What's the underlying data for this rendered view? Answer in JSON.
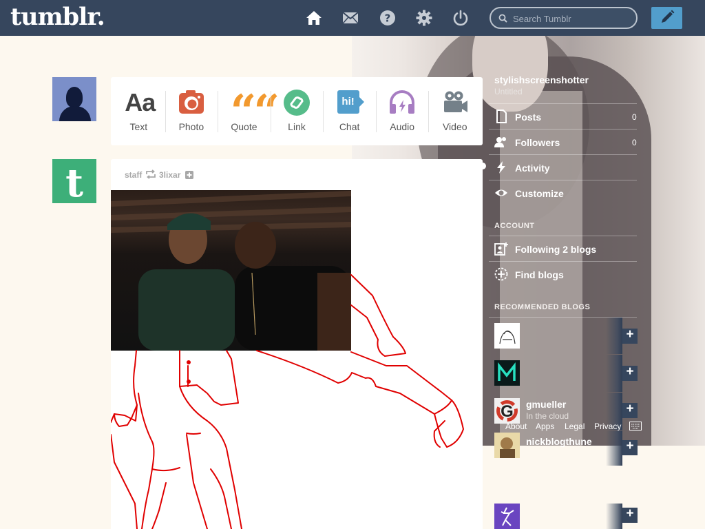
{
  "header": {
    "logo": "tumblr.",
    "search_placeholder": "Search Tumblr",
    "nav_icons": [
      "home-icon",
      "mail-icon",
      "help-icon",
      "gear-icon",
      "power-icon"
    ]
  },
  "post_types": [
    {
      "label": "Text",
      "icon": "text-icon",
      "glyph": "Aa",
      "color": "#444444"
    },
    {
      "label": "Photo",
      "icon": "camera-icon",
      "color": "#d95e40"
    },
    {
      "label": "Quote",
      "icon": "quote-icon",
      "glyph": "““",
      "color": "#f2992e"
    },
    {
      "label": "Link",
      "icon": "link-icon",
      "color": "#56bc8a"
    },
    {
      "label": "Chat",
      "icon": "chat-icon",
      "glyph": "hi!",
      "color": "#529ecc"
    },
    {
      "label": "Audio",
      "icon": "headphones-icon",
      "color": "#a77dc2"
    },
    {
      "label": "Video",
      "icon": "video-camera-icon",
      "color": "#748089"
    }
  ],
  "post": {
    "author": "staff",
    "source": "3lixar"
  },
  "sidebar": {
    "blog_name": "stylishscreenshotter",
    "blog_title": "Untitled",
    "menu": [
      {
        "label": "Posts",
        "icon": "document-icon",
        "count": "0"
      },
      {
        "label": "Followers",
        "icon": "followers-icon",
        "count": "0"
      },
      {
        "label": "Activity",
        "icon": "lightning-icon",
        "count": ""
      },
      {
        "label": "Customize",
        "icon": "eye-icon",
        "count": ""
      }
    ],
    "account_heading": "ACCOUNT",
    "account_items": [
      {
        "label": "Following 2 blogs",
        "icon": "add-person-icon"
      },
      {
        "label": "Find blogs",
        "icon": "compass-icon"
      }
    ],
    "recommended_heading": "RECOMMENDED BLOGS",
    "recommended": [
      {
        "name": "",
        "desc": ""
      },
      {
        "name": "",
        "desc": ""
      },
      {
        "name": "gmueller",
        "desc": "In the cloud"
      },
      {
        "name": "nickblogthune",
        "desc": ""
      },
      {
        "name": "",
        "desc": ""
      }
    ],
    "footer_links": [
      "About",
      "Apps",
      "Legal",
      "Privacy"
    ]
  }
}
